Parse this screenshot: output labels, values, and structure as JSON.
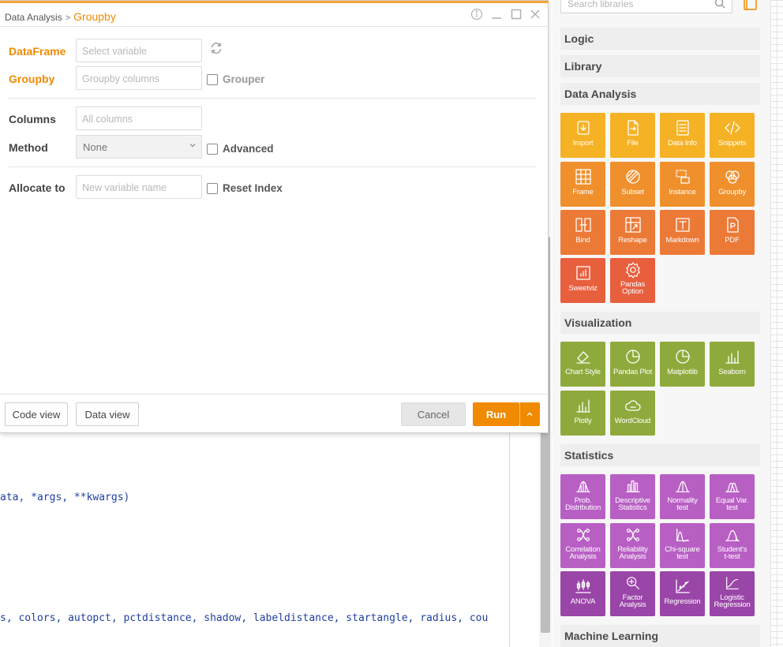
{
  "dialog": {
    "breadcrumb_parent": "Data Analysis",
    "breadcrumb_sep": ">",
    "breadcrumb_current": "Groupby",
    "fields": {
      "dataframe_label": "DataFrame",
      "dataframe_placeholder": "Select variable",
      "groupby_label": "Groupby",
      "groupby_placeholder": "Groupby columns",
      "grouper_label": "Grouper",
      "columns_label": "Columns",
      "columns_placeholder": "All columns",
      "method_label": "Method",
      "method_value": "None",
      "advanced_label": "Advanced",
      "allocate_label": "Allocate to",
      "allocate_placeholder": "New variable name",
      "reset_index_label": "Reset Index"
    },
    "footer": {
      "code_view": "Code view",
      "data_view": "Data view",
      "cancel": "Cancel",
      "run": "Run"
    }
  },
  "code": {
    "line1": "ata, *args, **kwargs)",
    "line2": "s, colors, autopct, pctdistance, shadow, labeldistance, startangle, radius, cou"
  },
  "library": {
    "search_placeholder": "Search libraries",
    "categories": {
      "logic": "Logic",
      "library": "Library",
      "data_analysis": "Data Analysis",
      "visualization": "Visualization",
      "statistics": "Statistics",
      "machine_learning": "Machine Learning"
    },
    "data_analysis": [
      "Import",
      "File",
      "Data Info",
      "Snippets",
      "Frame",
      "Subset",
      "Instance",
      "Groupby",
      "Bind",
      "Reshape",
      "Markdown",
      "PDF",
      "Sweetviz",
      "Pandas\nOption"
    ],
    "visualization": [
      "Chart Style",
      "Pandas Plot",
      "Matplotlib",
      "Seaborn",
      "Plotly",
      "WordCloud"
    ],
    "statistics": [
      "Prob.\nDistribution",
      "Descriptive\nStatistics",
      "Normality\ntest",
      "Equal Var.\ntest",
      "Correlation\nAnalysis",
      "Reliability\nAnalysis",
      "Chi-square\ntest",
      "Student's\nt-test",
      "ANOVA",
      "Factor\nAnalysis",
      "Regression",
      "Logistic\nRegression"
    ]
  },
  "colors": {
    "accent": "#f08a00",
    "data_row1": "#f5b225",
    "data_row2": "#f0902c",
    "data_row3": "#ec7a37",
    "data_row4": "#e85f3e",
    "visualization": "#8faa3c",
    "statistics": "#b85fc4",
    "statistics_dark": "#9a45a8"
  }
}
